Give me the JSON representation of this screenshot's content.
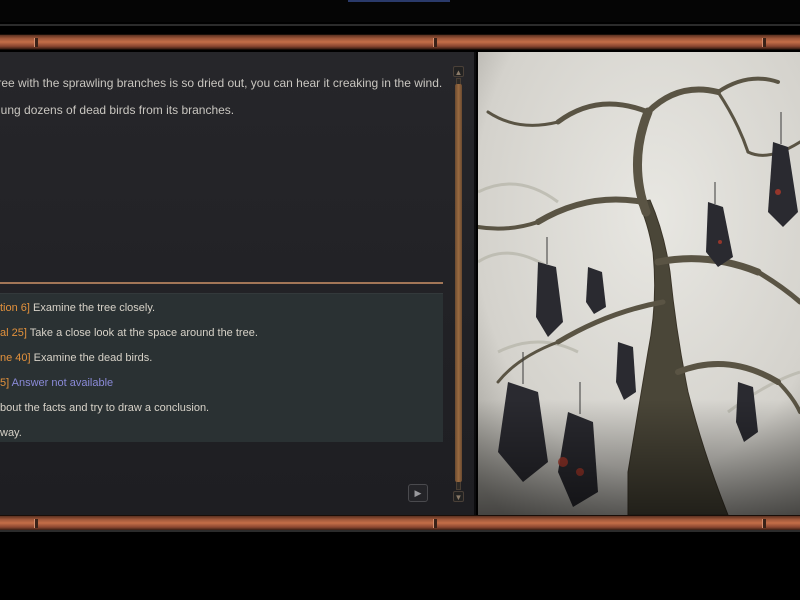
{
  "story": {
    "lines": [
      "tree with the sprawling branches is so dried out, you can hear it creaking in the wind.",
      "hung dozens of dead birds from its branches."
    ]
  },
  "choices": [
    {
      "tag": "tion 6]",
      "text": "Examine the tree closely.",
      "available": true
    },
    {
      "tag": "al 25]",
      "text": "Take a close look at the space around the tree.",
      "available": true
    },
    {
      "tag": "ne 40]",
      "text": "Examine the dead birds.",
      "available": true
    },
    {
      "tag": "5]",
      "text": "Answer not available",
      "available": false
    },
    {
      "tag": "",
      "text": "bout the facts and try to draw a conclusion.",
      "available": true
    },
    {
      "tag": "",
      "text": "way.",
      "available": true
    }
  ],
  "icons": {
    "scroll_up": "scroll-up-icon",
    "scroll_down": "scroll-down-icon",
    "play": "play-icon"
  },
  "colors": {
    "choice_tag": "#e2913c",
    "choice_text": "#d7d2c8",
    "unavailable_text": "#8a8ad8",
    "frame_copper": "#c46e48"
  }
}
